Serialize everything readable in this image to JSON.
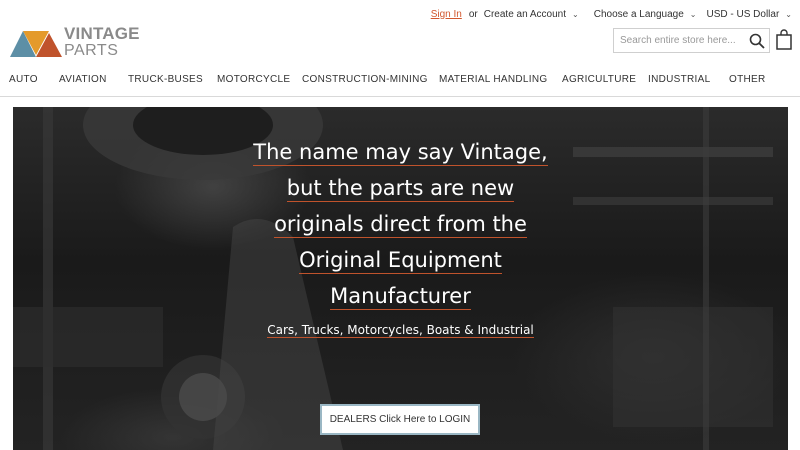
{
  "header": {
    "sign_in": "Sign In",
    "or": "or",
    "create_account": "Create an Account",
    "language": "Choose a Language",
    "currency": "USD - US Dollar"
  },
  "logo": {
    "line1": "VINTAGE",
    "line2": "PARTS",
    "colors": {
      "blue": "#5d8fa6",
      "orange": "#e49a2b",
      "red": "#c0532c"
    }
  },
  "search": {
    "placeholder": "Search entire store here..."
  },
  "icons": {
    "search": "search-icon",
    "cart": "shopping-bag-icon",
    "dropdown": "chevron-down-icon"
  },
  "nav": {
    "items": [
      "AUTO",
      "AVIATION",
      "TRUCK-BUSES",
      "MOTORCYCLE",
      "CONSTRUCTION-MINING",
      "MATERIAL HANDLING",
      "AGRICULTURE",
      "INDUSTRIAL",
      "OTHER"
    ]
  },
  "hero": {
    "headline_lines": [
      "The name may say Vintage,",
      "but the parts are new",
      "originals direct from the",
      "Original Equipment",
      "Manufacturer"
    ],
    "subheading": "Cars, Trucks, Motorcycles, Boats & Industrial",
    "dealer_button": "DEALERS Click Here to LOGIN"
  },
  "colors": {
    "accent": "#d2572e",
    "underline": "#c0532c",
    "button_border": "#9ab7c4"
  }
}
